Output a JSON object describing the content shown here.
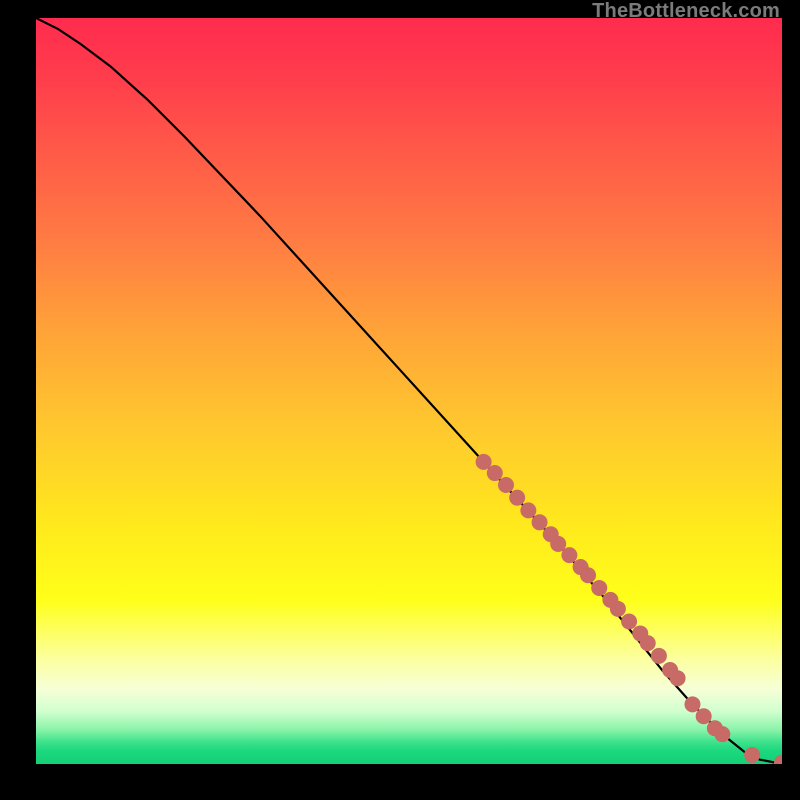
{
  "watermark": "TheBottleneck.com",
  "colors": {
    "curve": "#000000",
    "marker_fill": "#c86a66",
    "marker_stroke": "#c86a66"
  },
  "chart_data": {
    "type": "line",
    "title": "",
    "xlabel": "",
    "ylabel": "",
    "xrange": [
      0,
      100
    ],
    "yrange": [
      0,
      100
    ],
    "series": [
      {
        "name": "curve",
        "x": [
          0,
          3,
          6,
          10,
          15,
          20,
          30,
          40,
          50,
          60,
          70,
          76,
          80,
          84,
          88,
          92,
          95,
          97,
          99,
          100
        ],
        "y": [
          100,
          98.5,
          96.5,
          93.5,
          89.0,
          84.0,
          73.5,
          62.5,
          51.5,
          40.5,
          29.5,
          22.5,
          17.5,
          12.5,
          8.0,
          4.0,
          1.6,
          0.6,
          0.2,
          0.2
        ]
      }
    ],
    "markers": {
      "name": "samples",
      "x": [
        60,
        61.5,
        63,
        64.5,
        66,
        67.5,
        69,
        70,
        71.5,
        73,
        74,
        75.5,
        77,
        78,
        79.5,
        81,
        82,
        83.5,
        85,
        86,
        88,
        89.5,
        91,
        92,
        96,
        100
      ],
      "y": [
        40.5,
        39.0,
        37.4,
        35.7,
        34.0,
        32.4,
        30.8,
        29.5,
        28.0,
        26.4,
        25.3,
        23.6,
        22.0,
        20.8,
        19.1,
        17.5,
        16.2,
        14.5,
        12.6,
        11.5,
        8.0,
        6.4,
        4.8,
        4.0,
        1.2,
        0.2
      ],
      "r": 8
    }
  }
}
